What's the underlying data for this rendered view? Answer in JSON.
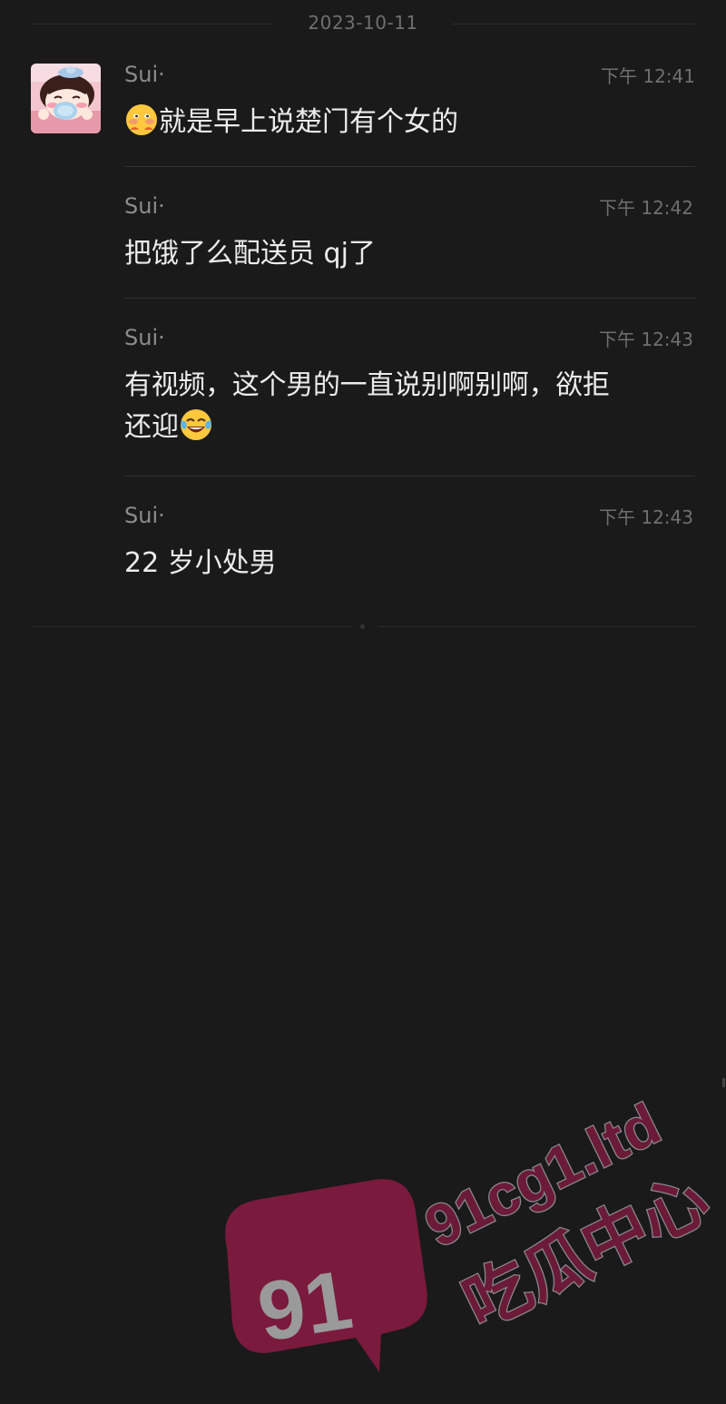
{
  "date_divider": "2023-10-11",
  "messages": [
    {
      "sender": "Sui·",
      "time": "下午 12:41",
      "text": "就是早上说楚门有个女的",
      "emoji": "blushing-hands-emoji"
    },
    {
      "sender": "Sui·",
      "time": "下午 12:42",
      "text": "把饿了么配送员 qj了"
    },
    {
      "sender": "Sui·",
      "time": "下午 12:43",
      "text_line1": "有视频，这个男的一直说别啊别啊，欲拒",
      "text_line2": "还迎",
      "emoji": "tears-of-joy-emoji"
    },
    {
      "sender": "Sui·",
      "time": "下午 12:43",
      "text": "22 岁小处男"
    }
  ],
  "watermark": {
    "badge_number": "91",
    "domain": "91cg1.ltd",
    "slogan": "吃瓜中心",
    "color": "#7a1a3c"
  },
  "colors": {
    "background": "#1a1a1a",
    "sender": "#8c8c8c",
    "text": "#ececec",
    "time": "#6f6f6f"
  }
}
